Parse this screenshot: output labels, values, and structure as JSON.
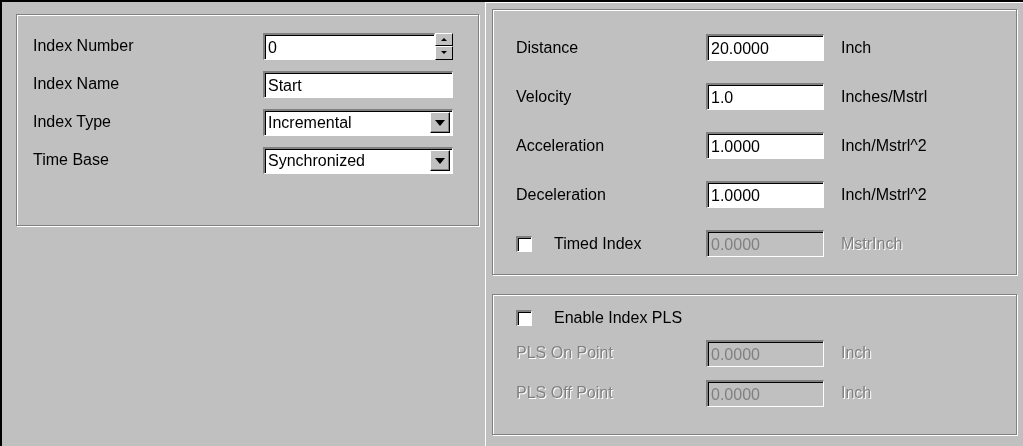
{
  "index_group": {
    "rows": [
      {
        "kind": "spinner",
        "label": "Index Number",
        "value": "0"
      },
      {
        "kind": "text",
        "label": "Index Name",
        "value": "Start"
      },
      {
        "kind": "dropdown",
        "label": "Index Type",
        "value": "Incremental"
      },
      {
        "kind": "dropdown",
        "label": "Time Base",
        "value": "Synchronized"
      }
    ]
  },
  "motion_group": {
    "rows": [
      {
        "kind": "text",
        "label": "Distance",
        "value": "20.0000",
        "unit": "Inch",
        "disabled": false
      },
      {
        "kind": "text",
        "label": "Velocity",
        "value": "1.0",
        "unit": "Inches/Mstrl",
        "disabled": false
      },
      {
        "kind": "text",
        "label": "Acceleration",
        "value": "1.0000",
        "unit": "Inch/Mstrl^2",
        "disabled": false
      },
      {
        "kind": "text",
        "label": "Deceleration",
        "value": "1.0000",
        "unit": "Inch/Mstrl^2",
        "disabled": false
      },
      {
        "kind": "checkbox",
        "label": "Timed Index",
        "checked": false,
        "value": "0.0000",
        "unit": "MstrInch",
        "disabled": true
      }
    ]
  },
  "pls_group": {
    "enable": {
      "label": "Enable Index PLS",
      "checked": false
    },
    "rows": [
      {
        "label": "PLS On Point",
        "value": "0.0000",
        "unit": "Inch",
        "disabled": true
      },
      {
        "label": "PLS Off Point",
        "value": "0.0000",
        "unit": "Inch",
        "disabled": true
      }
    ]
  }
}
